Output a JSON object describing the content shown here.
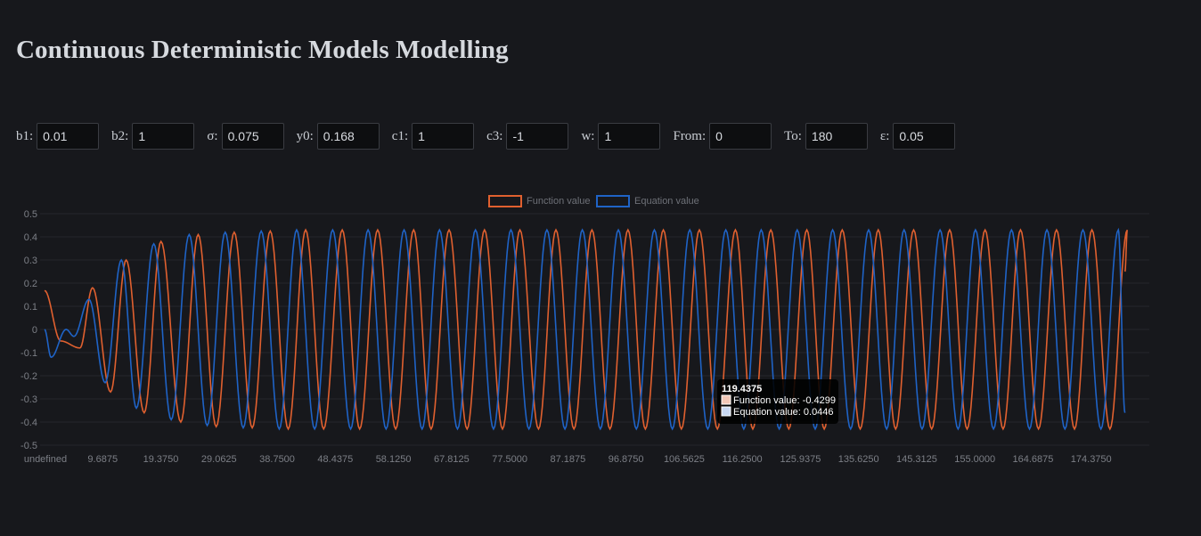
{
  "page": {
    "title": "Continuous Deterministic Models Modelling"
  },
  "params": [
    {
      "label": "b1:",
      "value": "0.01"
    },
    {
      "label": "b2:",
      "value": "1"
    },
    {
      "label": "σ:",
      "value": "0.075"
    },
    {
      "label": "y0:",
      "value": "0.168"
    },
    {
      "label": "c1:",
      "value": "1"
    },
    {
      "label": "c3:",
      "value": "-1"
    },
    {
      "label": "w:",
      "value": "1"
    },
    {
      "label": "From:",
      "value": "0"
    },
    {
      "label": "To:",
      "value": "180"
    },
    {
      "label": "ε:",
      "value": "0.05"
    }
  ],
  "chart_data": {
    "type": "line",
    "title": "",
    "xlabel": "",
    "ylabel": "",
    "xlim": [
      0,
      184.0625
    ],
    "ylim": [
      -0.5,
      0.5
    ],
    "x_tick_labels": [
      "undefined",
      "9.6875",
      "19.3750",
      "29.0625",
      "38.7500",
      "48.4375",
      "58.1250",
      "67.8125",
      "77.5000",
      "87.1875",
      "96.8750",
      "106.5625",
      "116.2500",
      "125.9375",
      "135.6250",
      "145.3125",
      "155.0000",
      "164.6875",
      "174.3750"
    ],
    "y_ticks": [
      0.5,
      0.4,
      0.3,
      0.2,
      0.1,
      0,
      -0.1,
      -0.2,
      -0.3,
      -0.4,
      -0.5
    ],
    "y_tick_labels": [
      "0.5",
      "0.4",
      "0.3",
      "0.2",
      "0.1",
      "0",
      "-0.1",
      "-0.2",
      "-0.3",
      "-0.4",
      "-0.5"
    ],
    "legend_position": "top",
    "series": [
      {
        "name": "Function value",
        "color": "#e0602f",
        "amplitude": 0.43,
        "start_value": 0.168,
        "peaks": [
          [
            8.0,
            0.18
          ],
          [
            13.6,
            0.3
          ],
          [
            19.4,
            0.38
          ],
          [
            25.6,
            0.41
          ],
          [
            31.6,
            0.42
          ],
          [
            37.6,
            0.425
          ],
          [
            43.5,
            0.43
          ],
          [
            49.6,
            0.43
          ],
          [
            55.5,
            0.43
          ],
          [
            61.5,
            0.43
          ],
          [
            67.4,
            0.43
          ],
          [
            73.3,
            0.43
          ],
          [
            79.2,
            0.43
          ],
          [
            85.2,
            0.43
          ],
          [
            91.2,
            0.43
          ],
          [
            97.2,
            0.43
          ],
          [
            103.1,
            0.43
          ],
          [
            109.1,
            0.43
          ],
          [
            115.1,
            0.43
          ],
          [
            121.0,
            0.43
          ],
          [
            127.0,
            0.43
          ],
          [
            132.9,
            0.43
          ],
          [
            138.9,
            0.43
          ],
          [
            144.8,
            0.43
          ],
          [
            150.8,
            0.43
          ],
          [
            156.7,
            0.43
          ],
          [
            162.6,
            0.43
          ],
          [
            168.6,
            0.43
          ],
          [
            174.5,
            0.43
          ],
          [
            180.4,
            0.43
          ]
        ],
        "troughs": [
          [
            2.7,
            -0.05
          ],
          [
            5.9,
            -0.08
          ],
          [
            11.0,
            -0.27
          ],
          [
            16.6,
            -0.36
          ],
          [
            22.7,
            -0.4
          ],
          [
            28.6,
            -0.42
          ],
          [
            34.6,
            -0.425
          ],
          [
            40.6,
            -0.43
          ],
          [
            46.5,
            -0.43
          ],
          [
            52.5,
            -0.43
          ],
          [
            58.5,
            -0.43
          ],
          [
            64.4,
            -0.43
          ],
          [
            70.4,
            -0.43
          ],
          [
            76.3,
            -0.43
          ],
          [
            82.3,
            -0.43
          ],
          [
            88.2,
            -0.43
          ],
          [
            94.2,
            -0.43
          ],
          [
            100.1,
            -0.43
          ],
          [
            106.1,
            -0.43
          ],
          [
            112.1,
            -0.43
          ],
          [
            118.0,
            -0.43
          ],
          [
            124.0,
            -0.43
          ],
          [
            129.9,
            -0.43
          ],
          [
            135.9,
            -0.43
          ],
          [
            141.8,
            -0.43
          ],
          [
            147.8,
            -0.43
          ],
          [
            153.7,
            -0.43
          ],
          [
            159.7,
            -0.43
          ],
          [
            165.6,
            -0.43
          ],
          [
            171.6,
            -0.43
          ],
          [
            177.5,
            -0.43
          ]
        ],
        "end_value": 0.25
      },
      {
        "name": "Equation value",
        "color": "#1f63c6",
        "amplitude": 0.43,
        "start_value": 0.0,
        "peaks": [
          [
            3.6,
            0.0
          ],
          [
            7.4,
            0.13
          ],
          [
            12.8,
            0.3
          ],
          [
            18.2,
            0.37
          ],
          [
            24.1,
            0.41
          ],
          [
            30.1,
            0.42
          ],
          [
            36.1,
            0.425
          ],
          [
            42.0,
            0.43
          ],
          [
            48.0,
            0.43
          ],
          [
            53.9,
            0.43
          ],
          [
            59.9,
            0.43
          ],
          [
            65.8,
            0.43
          ],
          [
            71.8,
            0.43
          ],
          [
            77.7,
            0.43
          ],
          [
            83.7,
            0.43
          ],
          [
            89.6,
            0.43
          ],
          [
            95.6,
            0.43
          ],
          [
            101.6,
            0.43
          ],
          [
            107.5,
            0.43
          ],
          [
            113.5,
            0.43
          ],
          [
            119.4,
            0.43
          ],
          [
            125.4,
            0.43
          ],
          [
            131.3,
            0.43
          ],
          [
            137.3,
            0.43
          ],
          [
            143.2,
            0.43
          ],
          [
            149.2,
            0.43
          ],
          [
            155.1,
            0.43
          ],
          [
            161.1,
            0.43
          ],
          [
            167.0,
            0.43
          ],
          [
            173.0,
            0.43
          ],
          [
            178.9,
            0.43
          ]
        ],
        "troughs": [
          [
            1.1,
            -0.12
          ],
          [
            4.9,
            -0.03
          ],
          [
            10.1,
            -0.23
          ],
          [
            15.3,
            -0.34
          ],
          [
            21.1,
            -0.39
          ],
          [
            27.1,
            -0.415
          ],
          [
            33.1,
            -0.425
          ],
          [
            39.1,
            -0.43
          ],
          [
            45.0,
            -0.43
          ],
          [
            51.0,
            -0.43
          ],
          [
            56.9,
            -0.43
          ],
          [
            62.9,
            -0.43
          ],
          [
            68.8,
            -0.43
          ],
          [
            74.8,
            -0.43
          ],
          [
            80.7,
            -0.43
          ],
          [
            86.7,
            -0.43
          ],
          [
            92.6,
            -0.43
          ],
          [
            98.6,
            -0.43
          ],
          [
            104.6,
            -0.43
          ],
          [
            110.5,
            -0.43
          ],
          [
            116.5,
            -0.43
          ],
          [
            122.4,
            -0.43
          ],
          [
            128.4,
            -0.43
          ],
          [
            134.3,
            -0.43
          ],
          [
            140.3,
            -0.43
          ],
          [
            146.2,
            -0.43
          ],
          [
            152.2,
            -0.43
          ],
          [
            158.1,
            -0.43
          ],
          [
            164.1,
            -0.43
          ],
          [
            170.0,
            -0.43
          ],
          [
            176.0,
            -0.43
          ]
        ],
        "end_value": -0.36
      }
    ],
    "tooltip": {
      "title": "119.4375",
      "lines": [
        "Function value: -0.4299",
        "Equation value: 0.0446"
      ]
    }
  }
}
